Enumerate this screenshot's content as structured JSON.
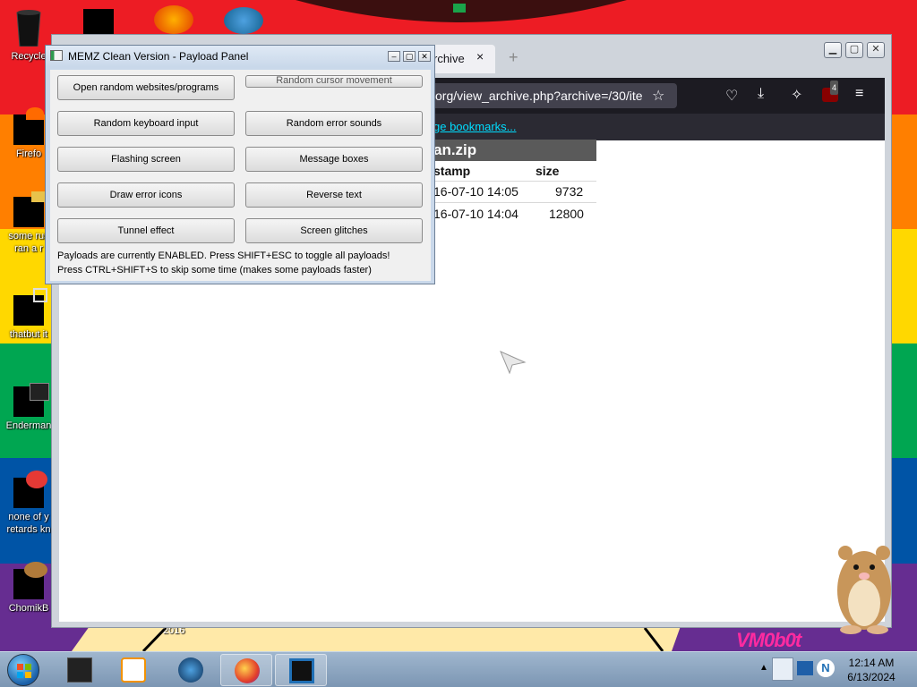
{
  "desktop": {
    "icons": [
      {
        "label": "Recycle",
        "icon": "recycle-bin-icon"
      },
      {
        "label": "Firefo",
        "icon": "firefox-icon"
      },
      {
        "label": "some rus",
        "label2": "ran a r",
        "icon": "folder-icon"
      },
      {
        "label": "thatbut it",
        "icon": "stack-icon"
      },
      {
        "label": "Enderman",
        "icon": "app-icon"
      },
      {
        "label": "none of y",
        "label2": "retards kn",
        "icon": "chrome-icon"
      },
      {
        "label": "ChomikB",
        "icon": "hamster-icon"
      }
    ],
    "wallpaper_stripes": [
      "#ed1c24",
      "#ff7f00",
      "#ffd800",
      "#00a651",
      "#0054a6",
      "#662d91"
    ],
    "wallpaper_text": "VM0b0t",
    "wallpaper_year": "2016"
  },
  "browser": {
    "tab_label": "rchive",
    "tab_close": "×",
    "new_tab": "+",
    "url": "org/view_archive.php?archive=/30/ite",
    "bookmarks_link": "ge bookmarks...",
    "extension_badge": "4",
    "archive": {
      "title": "an.zip",
      "columns": [
        "stamp",
        "size"
      ],
      "rows": [
        {
          "stamp": "16-07-10 14:05",
          "size": "9732"
        },
        {
          "stamp": "16-07-10 14:04",
          "size": "12800"
        }
      ]
    }
  },
  "memz": {
    "title": "MEMZ Clean Version - Payload Panel",
    "buttons": [
      "Open random websites/programs",
      "Random cursor movement",
      "Random keyboard input",
      "Random error sounds",
      "Flashing screen",
      "Message boxes",
      "Draw error icons",
      "Reverse text",
      "Tunnel effect",
      "Screen glitches"
    ],
    "status_line1": "Payloads are currently ENABLED. Press SHIFT+ESC to toggle all payloads!",
    "status_line2": "Press CTRL+SHIFT+S to skip some time (makes some payloads faster)"
  },
  "taskbar": {
    "time": "12:14 AM",
    "date": "6/13/2024"
  },
  "colors": {
    "browser_toolbar": "#1c1b22",
    "link": "#00ddff",
    "memz_chrome": "#c9d8ea"
  }
}
